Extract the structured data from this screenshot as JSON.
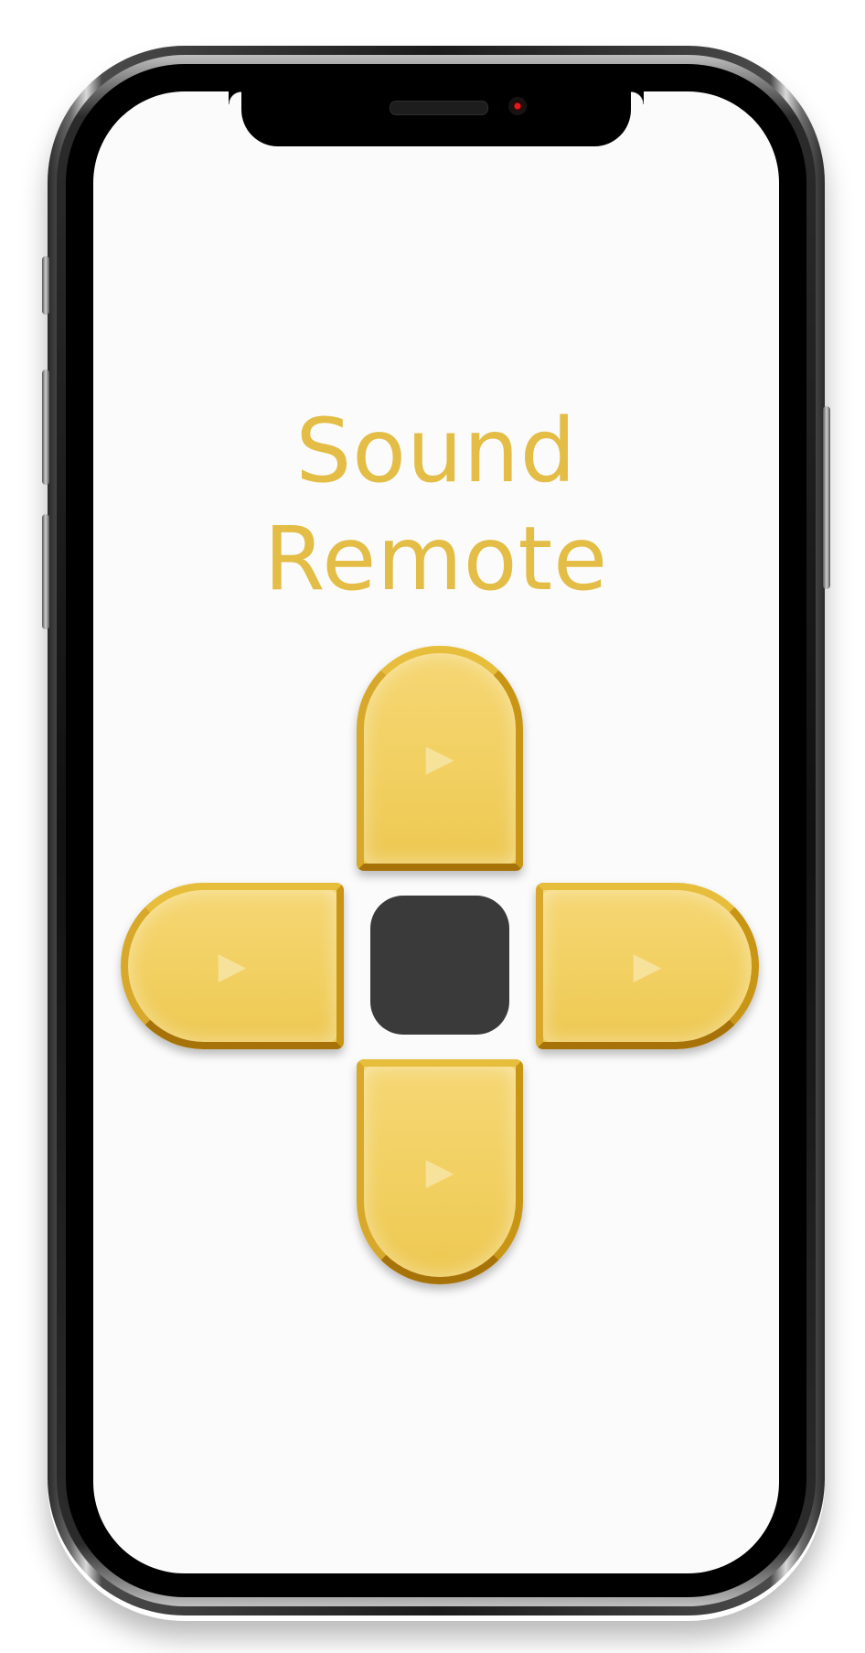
{
  "app": {
    "title_line1": "Sound",
    "title_line2": "Remote"
  },
  "dpad": {
    "up_icon": "▶",
    "down_icon": "▶",
    "left_icon": "▶",
    "right_icon": "▶"
  },
  "colors": {
    "title": "#e3bd45",
    "pad_fill": "#f1cf5f",
    "pad_border": "#c99514",
    "arrow": "#f8e6a6",
    "center_button": "#3a3a3a",
    "screen_background": "#fbfbfb"
  },
  "icons": {
    "pad_arrow": "play-triangle-icon",
    "center": "stop-square-icon"
  }
}
